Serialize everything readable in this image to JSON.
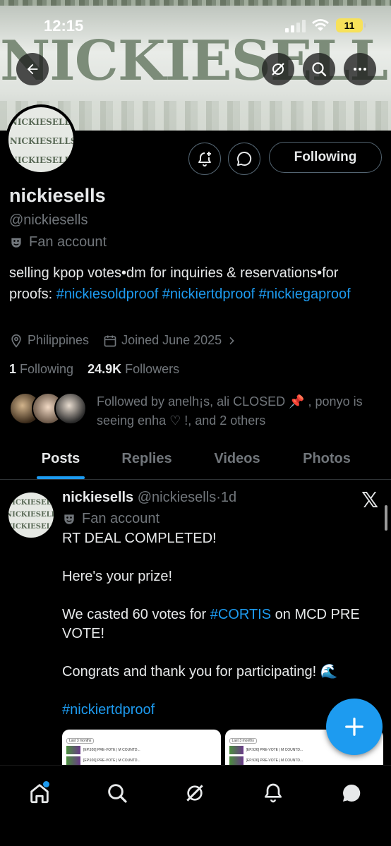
{
  "status_bar": {
    "time": "12:15",
    "battery": "11"
  },
  "banner": {
    "text": "NICKIESELLS"
  },
  "avatar": {
    "lines": [
      "NICKIESELLS",
      "NICKIESELLS",
      "NICKIESELLS"
    ]
  },
  "profile": {
    "follow_button": "Following",
    "name": "nickiesells",
    "handle": "@nickiesells",
    "label": "Fan account",
    "bio_text": "selling kpop votes•dm for inquiries & reservations•for proofs:",
    "bio_tags": [
      "#nickiesoldproof",
      "#nickiertdproof",
      "#nickiegaproof"
    ],
    "location": "Philippines",
    "joined": "Joined June 2025",
    "following_count": "1",
    "following_label": "Following",
    "followers_count": "24.9K",
    "followers_label": "Followers",
    "followed_by": "Followed by anelh¡s, ali CLOSED 📌 , ponyo is seeing enha ♡ !, and 2 others"
  },
  "tabs": [
    {
      "label": "Posts",
      "active": true
    },
    {
      "label": "Replies",
      "active": false
    },
    {
      "label": "Videos",
      "active": false
    },
    {
      "label": "Photos",
      "active": false
    }
  ],
  "post": {
    "name": "nickiesells",
    "handle": "@nickiesells",
    "time": "1d",
    "label": "Fan account",
    "line1": "RT DEAL COMPLETED!",
    "line2": "Here's your prize!",
    "line3_pre": "We casted 60 votes for",
    "line3_tag": "#CORTIS",
    "line3_post": "on MCD PRE VOTE!",
    "line4": "Congrats and thank you for participating! 🌊",
    "hashtag": "#nickiertdproof",
    "thumb_filter": "Last 3 months",
    "thumb_entry": "[EP.926] PRE-VOTE | M COUNTD..."
  },
  "colors": {
    "accent": "#1d9bf0",
    "muted": "#71767b",
    "text": "#e7e9ea"
  },
  "icons": [
    "back-arrow-icon",
    "grok-icon",
    "search-icon",
    "more-icon",
    "bell-plus-icon",
    "message-icon",
    "location-icon",
    "calendar-icon",
    "home-icon",
    "notifications-icon",
    "chat-icon",
    "compose-icon"
  ]
}
